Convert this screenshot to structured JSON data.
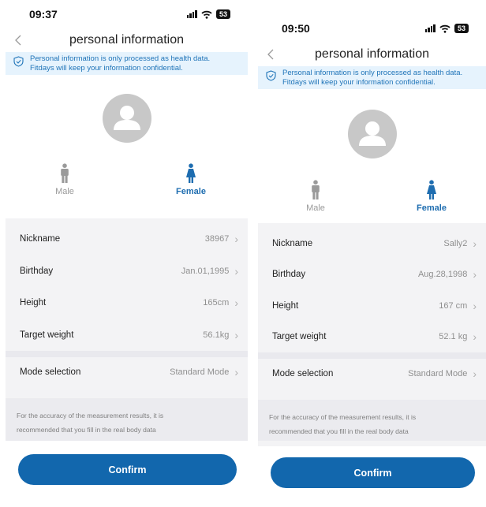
{
  "screens": [
    {
      "status": {
        "time": "09:37",
        "battery": "53"
      },
      "nav": {
        "title": "personal information"
      },
      "notice": {
        "line1": "Personal information is only processed as health data.",
        "line2": "Fitdays will keep your information confidential."
      },
      "gender": {
        "male": "Male",
        "female": "Female",
        "selected": "Female"
      },
      "fields": [
        {
          "label": "Nickname",
          "value": "38967"
        },
        {
          "label": "Birthday",
          "value": "Jan.01,1995"
        },
        {
          "label": "Height",
          "value": "165cm"
        },
        {
          "label": "Target weight",
          "value": "56.1kg"
        }
      ],
      "mode": {
        "label": "Mode selection",
        "value": "Standard Mode"
      },
      "hint": {
        "line1": "For the accuracy of the measurement results, it is",
        "line2": "recommended that you fill in the real body data"
      },
      "confirm_label": "Confirm"
    },
    {
      "status": {
        "time": "09:50",
        "battery": "53"
      },
      "nav": {
        "title": "personal information"
      },
      "notice": {
        "line1": "Personal information is only processed as health data.",
        "line2": "Fitdays will keep your information confidential."
      },
      "gender": {
        "male": "Male",
        "female": "Female",
        "selected": "Female"
      },
      "fields": [
        {
          "label": "Nickname",
          "value": "Sally2"
        },
        {
          "label": "Birthday",
          "value": "Aug.28,1998"
        },
        {
          "label": "Height",
          "value": "167 cm"
        },
        {
          "label": "Target weight",
          "value": "52.1 kg"
        }
      ],
      "mode": {
        "label": "Mode selection",
        "value": "Standard Mode"
      },
      "hint": {
        "line1": "For the accuracy of the measurement results, it is",
        "line2": "recommended that you fill in the real body data"
      },
      "confirm_label": "Confirm"
    }
  ],
  "colors": {
    "accent": "#1267ad",
    "notice_bg": "#e6f3fd",
    "notice_text": "#1f74b8",
    "male_gray": "#9a9a9a",
    "female_blue": "#1e6db0",
    "avatar_gray": "#c8c8c8"
  },
  "icons": {
    "back": "chevron-left-icon",
    "notice": "shield-check-icon",
    "male": "male-figure-icon",
    "female": "female-figure-icon",
    "avatar": "user-silhouette-icon",
    "row": "chevron-right-icon"
  }
}
